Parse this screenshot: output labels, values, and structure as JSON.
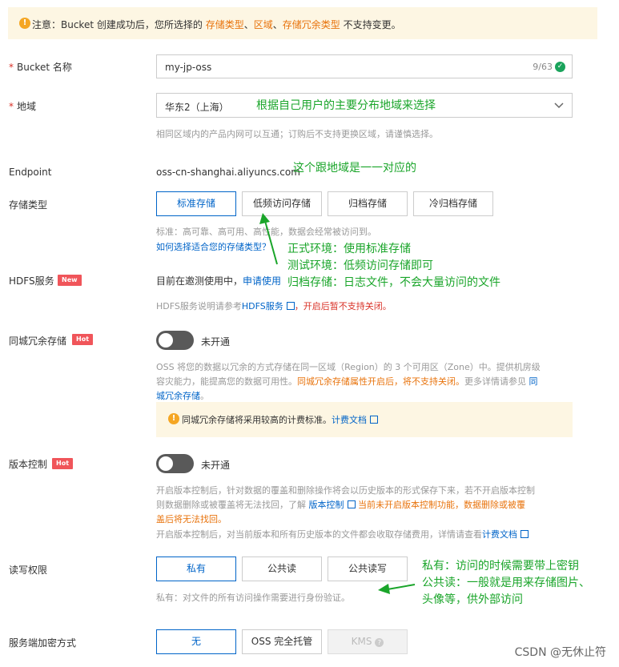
{
  "notice": {
    "icon": "warning-icon",
    "prefix": "注意：Bucket 创建成功后，您所选择的 ",
    "h1": "存储类型",
    "sep1": "、",
    "h2": "区域",
    "sep2": "、",
    "h3": "存储冗余类型",
    "suffix": " 不支持变更。"
  },
  "bucket_name": {
    "label": "Bucket 名称",
    "required_mark": "*",
    "value": "my-jp-oss",
    "count": "9/63"
  },
  "region": {
    "label": "地域",
    "required_mark": "*",
    "value": "华东2（上海）",
    "hint": "相同区域内的产品内网可以互通；订购后不支持更换区域，请谨慎选择。",
    "annotation": "根据自己用户的主要分布地域来选择"
  },
  "endpoint": {
    "label": "Endpoint",
    "value": "oss-cn-shanghai.aliyuncs.com",
    "annotation": "这个跟地域是一一对应的"
  },
  "storage_class": {
    "label": "存储类型",
    "options": [
      "标准存储",
      "低频访问存储",
      "归档存储",
      "冷归档存储"
    ],
    "selected": "标准存储",
    "hint": "标准：高可靠、高可用、高性能，数据会经常被访问到。",
    "link": "如何选择适合您的存储类型？",
    "annotation_lines": [
      "正式环境：使用标准存储",
      "测试环境：低频访问存储即可",
      "归档存储：日志文件，不会大量访问的文件"
    ]
  },
  "hdfs": {
    "label": "HDFS服务",
    "badge": "New",
    "text": "目前在邀测使用中，",
    "link": "申请使用",
    "hint_prefix": "HDFS服务说明请参考",
    "hint_link": "HDFS服务",
    "hint_red": "，开启后暂不支持关闭。"
  },
  "zrs": {
    "label": "同城冗余存储",
    "badge": "Hot",
    "toggle_label": "未开通",
    "toggle_on": false,
    "desc_line1": "OSS 将您的数据以冗余的方式存储在同一区域（Region）的 3 个可用区（Zone）中。提供机房级",
    "desc_line2_a": "容灾能力，能提高您的数据可用性。",
    "desc_line2_orange": "同城冗余存储属性开启后，将不支持关闭。",
    "desc_line2_b": "更多详情请参见 ",
    "desc_line2_link": "同",
    "desc_line3_link": "城冗余存储",
    "desc_line3_b": "。",
    "box_text": "同城冗余存储将采用较高的计费标准。",
    "box_link": "计费文档"
  },
  "versioning": {
    "label": "版本控制",
    "badge": "Hot",
    "toggle_label": "未开通",
    "toggle_on": false,
    "line1": "开启版本控制后，针对数据的覆盖和删除操作将会以历史版本的形式保存下来，若不开启版本控制",
    "line2_a": "则数据删除或被覆盖将无法找回，了解 ",
    "line2_link": "版本控制",
    "line2_orange": "当前未开启版本控制功能，数据删除或被覆",
    "line3_orange": "盖后将无法找回。",
    "line4_a": "开启版本控制后，对当前版本和所有历史版本的文件都会收取存储费用，详情请查看",
    "line4_link": "计费文档"
  },
  "acl": {
    "label": "读写权限",
    "options": [
      "私有",
      "公共读",
      "公共读写"
    ],
    "selected": "私有",
    "hint": "私有：对文件的所有访问操作需要进行身份验证。",
    "annotation_lines": [
      "私有：访问的时候需要带上密钥",
      "公共读：一般就是用来存储图片、",
      "头像等，供外部访问"
    ]
  },
  "encryption": {
    "label": "服务端加密方式",
    "options": [
      "无",
      "OSS 完全托管",
      "KMS"
    ],
    "selected": "无"
  },
  "watermark": "CSDN @无休止符",
  "colors": {
    "accent": "#0064c8",
    "annotation": "#1aa52a",
    "warning": "#f5a623",
    "tag": "#f0555a"
  }
}
